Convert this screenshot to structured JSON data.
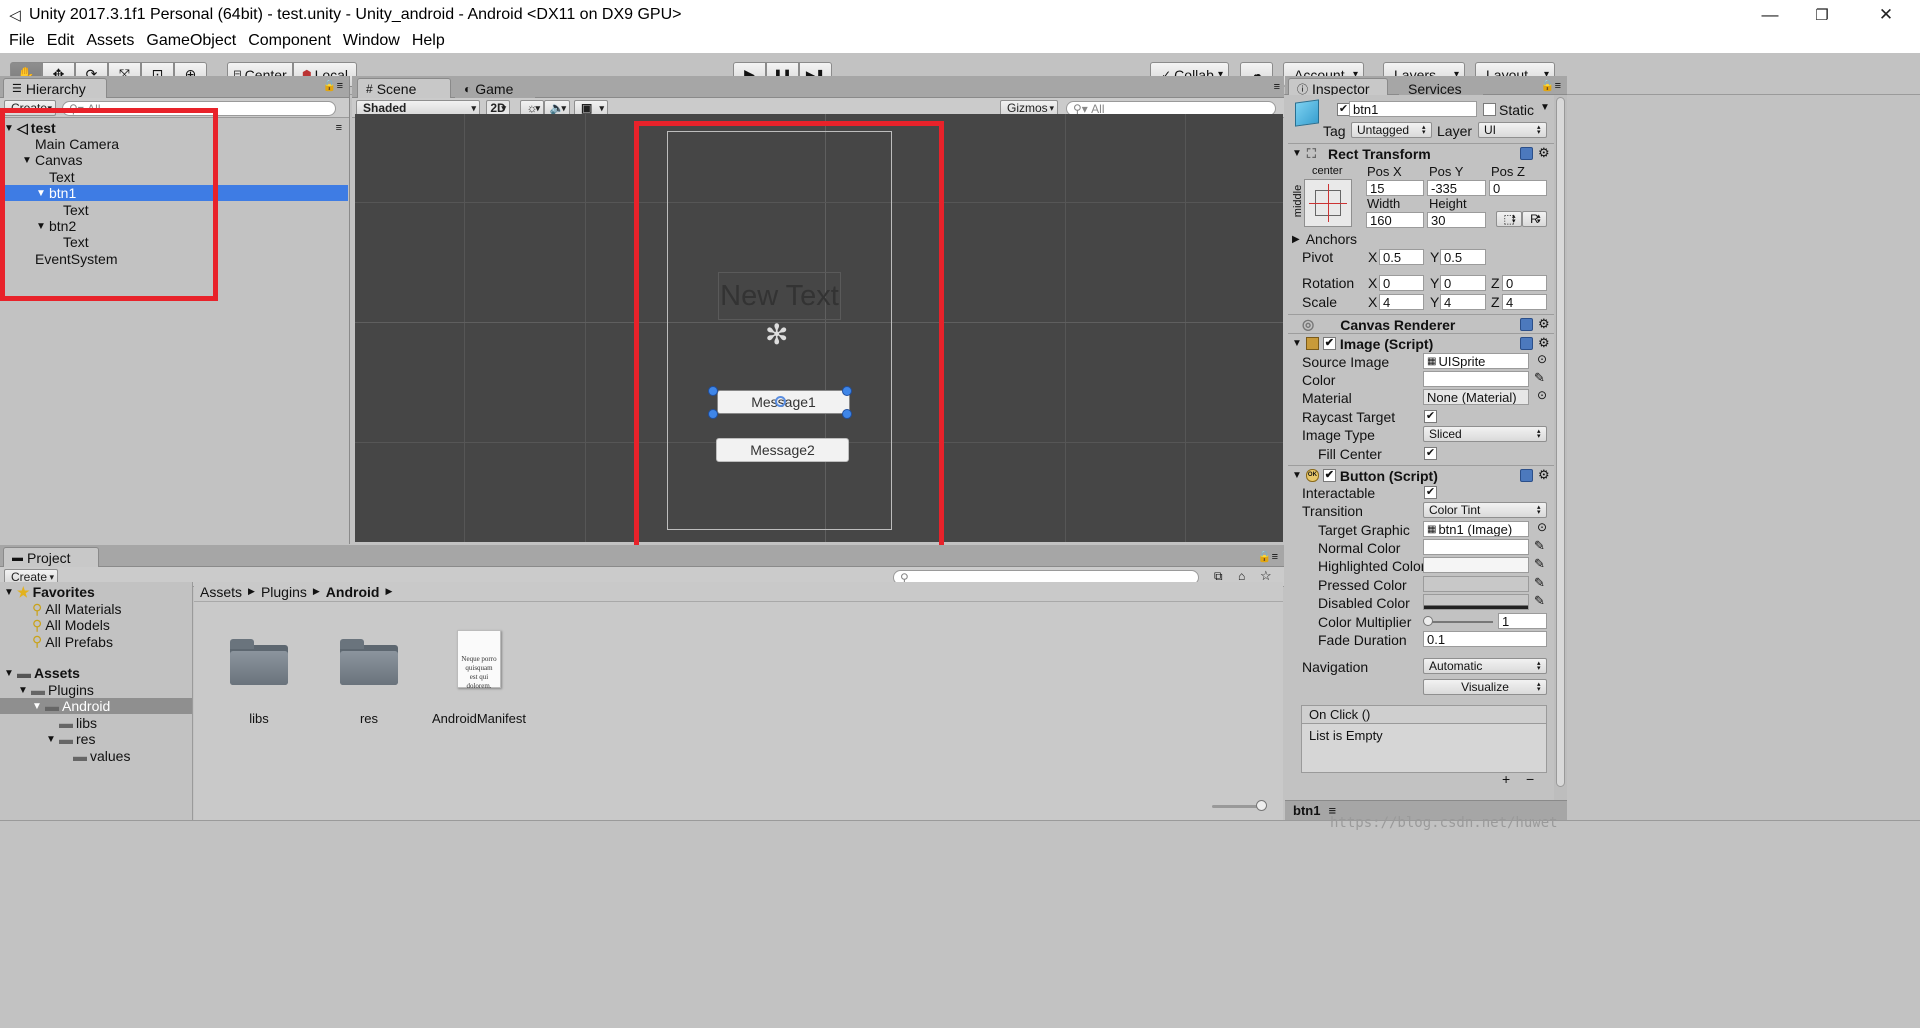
{
  "window": {
    "title": "Unity 2017.3.1f1 Personal (64bit) - test.unity - Unity_android - Android <DX11 on DX9 GPU>",
    "minimize": "—",
    "restore": "❐",
    "close": "✕"
  },
  "menu": [
    "File",
    "Edit",
    "Assets",
    "GameObject",
    "Component",
    "Window",
    "Help"
  ],
  "toolbar": {
    "tools": [
      "hand-tool",
      "move-tool",
      "rotate-tool",
      "scale-tool",
      "rect-tool",
      "transform-tool"
    ],
    "pivot_mode": "Center",
    "pivot_rotation": "Local",
    "play": "▶",
    "pause": "❚❚",
    "step": "▶❚",
    "collab": "Collab",
    "account": "Account",
    "layers": "Layers",
    "layout": "Layout"
  },
  "hierarchy": {
    "tab": "Hierarchy",
    "create": "Create",
    "search_placeholder": "All",
    "scene": "test",
    "items": [
      {
        "label": "Main Camera",
        "depth": 1,
        "expander": ""
      },
      {
        "label": "Canvas",
        "depth": 1,
        "expander": "▼"
      },
      {
        "label": "Text",
        "depth": 2,
        "expander": ""
      },
      {
        "label": "btn1",
        "depth": 2,
        "expander": "▼",
        "selected": true
      },
      {
        "label": "Text",
        "depth": 3,
        "expander": ""
      },
      {
        "label": "btn2",
        "depth": 2,
        "expander": "▼"
      },
      {
        "label": "Text",
        "depth": 3,
        "expander": ""
      },
      {
        "label": "EventSystem",
        "depth": 1,
        "expander": ""
      }
    ]
  },
  "scene_view": {
    "tab_scene": "Scene",
    "tab_game": "Game",
    "shading": "Shaded",
    "mode_2d": "2D",
    "gizmos": "Gizmos",
    "search_placeholder": "All",
    "canvas_text": "New Text",
    "button1": "Message1",
    "button2": "Message2"
  },
  "inspector": {
    "tab": "Inspector",
    "tab_services": "Services",
    "object_name": "btn1",
    "static_label": "Static",
    "tag_label": "Tag",
    "tag_value": "Untagged",
    "layer_label": "Layer",
    "layer_value": "UI",
    "rect_transform": {
      "title": "Rect Transform",
      "anchor_h": "center",
      "anchor_v": "middle",
      "pos_x_label": "Pos X",
      "pos_x": "15",
      "pos_y_label": "Pos Y",
      "pos_y": "-335",
      "pos_z_label": "Pos Z",
      "pos_z": "0",
      "width_label": "Width",
      "width": "160",
      "height_label": "Height",
      "height": "30",
      "r_button": "R",
      "anchors": "Anchors",
      "pivot": "Pivot",
      "pivot_x": "0.5",
      "pivot_y": "0.5",
      "rotation": "Rotation",
      "rot_x": "0",
      "rot_y": "0",
      "rot_z": "0",
      "scale": "Scale",
      "scale_x": "4",
      "scale_y": "4",
      "scale_z": "4",
      "x": "X",
      "y": "Y",
      "z": "Z"
    },
    "canvas_renderer": "Canvas Renderer",
    "image": {
      "title": "Image (Script)",
      "source_image_label": "Source Image",
      "source_image": "UISprite",
      "color_label": "Color",
      "material_label": "Material",
      "material": "None (Material)",
      "raycast_label": "Raycast Target",
      "image_type_label": "Image Type",
      "image_type": "Sliced",
      "fill_center_label": "Fill Center"
    },
    "button": {
      "title": "Button (Script)",
      "interactable_label": "Interactable",
      "transition_label": "Transition",
      "transition": "Color Tint",
      "target_graphic_label": "Target Graphic",
      "target_graphic": "btn1 (Image)",
      "normal_color_label": "Normal Color",
      "highlighted_color_label": "Highlighted Color",
      "pressed_color_label": "Pressed Color",
      "disabled_color_label": "Disabled Color",
      "color_multiplier_label": "Color Multiplier",
      "color_multiplier": "1",
      "fade_duration_label": "Fade Duration",
      "fade_duration": "0.1",
      "navigation_label": "Navigation",
      "navigation": "Automatic",
      "visualize": "Visualize",
      "on_click": "On Click ()",
      "list_empty": "List is Empty",
      "plus": "+",
      "minus": "−"
    },
    "footer_name": "btn1"
  },
  "project": {
    "tab": "Project",
    "create": "Create",
    "favorites": "Favorites",
    "favorite_items": [
      "All Materials",
      "All Models",
      "All Prefabs"
    ],
    "assets": "Assets",
    "tree": [
      {
        "label": "Plugins",
        "depth": 1,
        "expander": "▼"
      },
      {
        "label": "Android",
        "depth": 2,
        "expander": "▼",
        "selected": true
      },
      {
        "label": "libs",
        "depth": 3,
        "expander": ""
      },
      {
        "label": "res",
        "depth": 3,
        "expander": "▼"
      },
      {
        "label": "values",
        "depth": 4,
        "expander": ""
      }
    ],
    "breadcrumb": [
      "Assets",
      "Plugins",
      "Android"
    ],
    "files": [
      "libs",
      "res",
      "AndroidManifest"
    ],
    "manifest_thumb_text": "Neque porro quisquam est qui dolorem."
  },
  "watermark": "https://blog.csdn.net/huwet",
  "colors": {
    "selection": "#3e7ce4",
    "highlight_box": "#e8222a",
    "scene_bg": "#464646"
  }
}
